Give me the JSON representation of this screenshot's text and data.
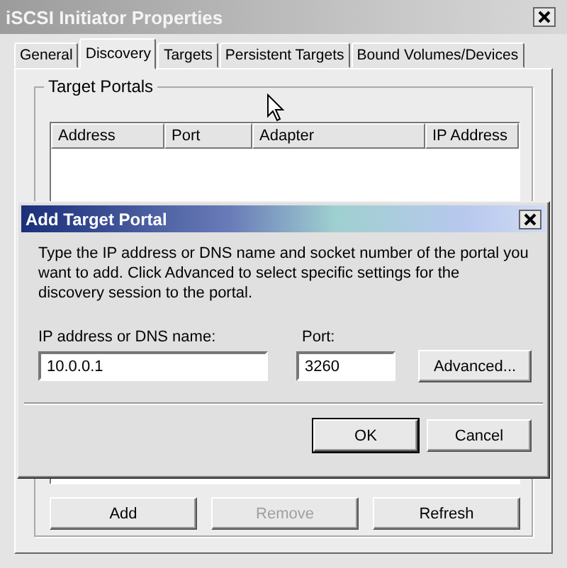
{
  "window": {
    "title": "iSCSI Initiator Properties"
  },
  "tabs": [
    {
      "label": "General",
      "selected": false
    },
    {
      "label": "Discovery",
      "selected": true
    },
    {
      "label": "Targets",
      "selected": false
    },
    {
      "label": "Persistent Targets",
      "selected": false
    },
    {
      "label": "Bound Volumes/Devices",
      "selected": false
    }
  ],
  "target_portals": {
    "title": "Target Portals",
    "columns": [
      "Address",
      "Port",
      "Adapter",
      "IP Address"
    ],
    "buttons": [
      {
        "label": "Add",
        "disabled": false
      },
      {
        "label": "Remove",
        "disabled": true
      },
      {
        "label": "Refresh",
        "disabled": false
      }
    ]
  },
  "dialog": {
    "title": "Add Target Portal",
    "description": "Type the IP address or DNS name and socket number of the portal you want to add. Click Advanced to select specific settings for the discovery session to the portal.",
    "address_label": "IP address or DNS name:",
    "address_value": "10.0.0.1",
    "port_label": "Port:",
    "port_value": "3260",
    "advanced_button": "Advanced...",
    "buttons": [
      {
        "label": "OK",
        "default": true
      },
      {
        "label": "Cancel",
        "default": false
      }
    ]
  }
}
